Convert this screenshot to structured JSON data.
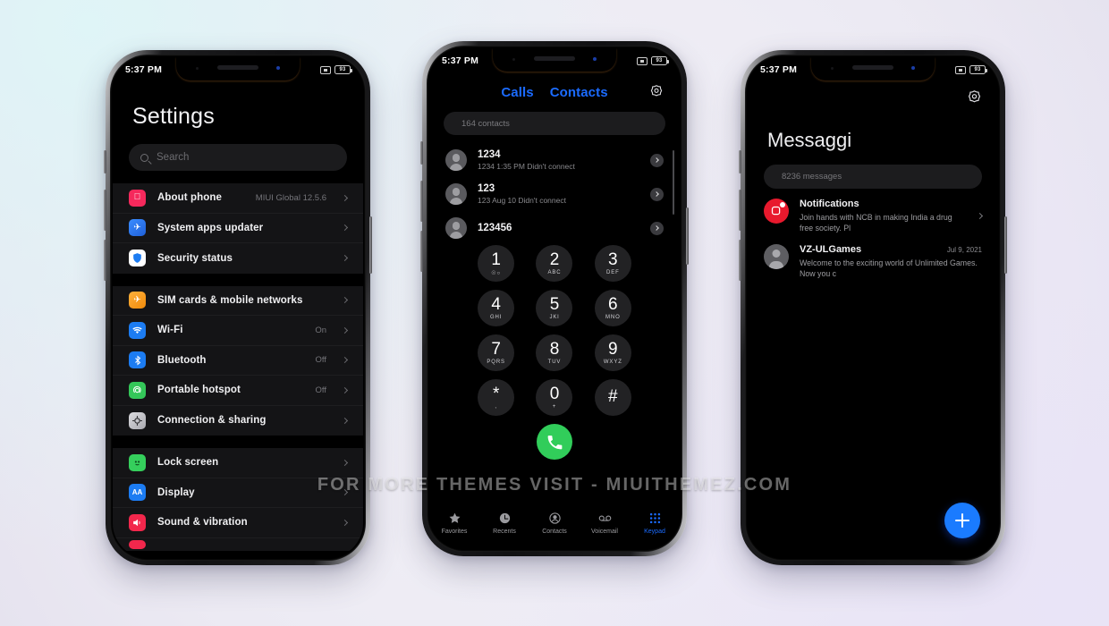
{
  "watermark": "FOR MORE THEMES VISIT - MIUITHEMEZ.COM",
  "colors": {
    "accent_blue": "#1b6bff",
    "fab_blue": "#1a7bff",
    "call_green": "#31cd5a",
    "screen_black": "#000000",
    "row_bg": "#141416"
  },
  "status_bar": {
    "time": "5:37 PM",
    "battery_percent": "93",
    "cast_icon": "cast-icon",
    "battery_icon": "battery-icon"
  },
  "settings_phone": {
    "title": "Settings",
    "search": {
      "placeholder": "Search",
      "icon": "search-icon"
    },
    "groups": [
      {
        "rows": [
          {
            "label": "About phone",
            "value": "MIUI Global 12.5.6",
            "icon": "apple-icon",
            "icon_bg": "#f5295c",
            "icon_glyph": ""
          },
          {
            "label": "System apps updater",
            "value": "",
            "icon": "rocket-icon",
            "icon_bg": "#2a7ff0",
            "icon_glyph": "✈"
          },
          {
            "label": "Security status",
            "value": "",
            "icon": "shield-icon",
            "icon_bg": "#ffffff",
            "icon_glyph": "⬟"
          }
        ]
      },
      {
        "rows": [
          {
            "label": "SIM cards & mobile networks",
            "value": "",
            "icon": "airplane-sim-icon",
            "icon_bg": "#f59b18",
            "icon_glyph": "✈"
          },
          {
            "label": "Wi-Fi",
            "value": "On",
            "icon": "wifi-icon",
            "icon_bg": "#1c7cf2",
            "icon_glyph": "◔"
          },
          {
            "label": "Bluetooth",
            "value": "Off",
            "icon": "bluetooth-icon",
            "icon_bg": "#1c7cf2",
            "icon_glyph": "ᛦ"
          },
          {
            "label": "Portable hotspot",
            "value": "Off",
            "icon": "hotspot-icon",
            "icon_bg": "#34c759",
            "icon_glyph": "@"
          },
          {
            "label": "Connection & sharing",
            "value": "",
            "icon": "gear-share-icon",
            "icon_bg": "#bdbdc2",
            "icon_glyph": "⚙"
          }
        ]
      },
      {
        "rows": [
          {
            "label": "Lock screen",
            "value": "",
            "icon": "lock-screen-icon",
            "icon_bg": "#35cf5c",
            "icon_glyph": "☺"
          },
          {
            "label": "Display",
            "value": "",
            "icon": "display-icon",
            "icon_bg": "#1c7cf2",
            "icon_glyph": "AA"
          },
          {
            "label": "Sound & vibration",
            "value": "",
            "icon": "sound-icon",
            "icon_bg": "#f2274c",
            "icon_glyph": "◀"
          }
        ]
      }
    ]
  },
  "dialer_phone": {
    "tabs": [
      {
        "label": "Calls"
      },
      {
        "label": "Contacts"
      }
    ],
    "settings_icon": "gear-icon",
    "search": {
      "placeholder": "164 contacts",
      "icon": "search-icon"
    },
    "calls": [
      {
        "name": "1234",
        "detail": "1234  1:35 PM Didn't connect"
      },
      {
        "name": "123",
        "detail": "123  Aug 10 Didn't connect"
      },
      {
        "name": "123456",
        "detail": ""
      }
    ],
    "keypad": [
      {
        "num": "1",
        "sub": "☉○"
      },
      {
        "num": "2",
        "sub": "ABC"
      },
      {
        "num": "3",
        "sub": "DEF"
      },
      {
        "num": "4",
        "sub": "GHI"
      },
      {
        "num": "5",
        "sub": "JKl"
      },
      {
        "num": "6",
        "sub": "MNO"
      },
      {
        "num": "7",
        "sub": "PQRS"
      },
      {
        "num": "8",
        "sub": "TUV"
      },
      {
        "num": "9",
        "sub": "WXYZ"
      },
      {
        "num": "*",
        "sub": ","
      },
      {
        "num": "0",
        "sub": "+"
      },
      {
        "num": "#",
        "sub": ""
      }
    ],
    "call_button": "call-button",
    "tabbar": [
      {
        "label": "Favorites",
        "icon": "star-icon",
        "active": false
      },
      {
        "label": "Recents",
        "icon": "clock-icon",
        "active": false
      },
      {
        "label": "Contacts",
        "icon": "person-circle-icon",
        "active": false
      },
      {
        "label": "Voicemail",
        "icon": "voicemail-icon",
        "active": false
      },
      {
        "label": "Keypad",
        "icon": "keypad-icon",
        "active": true
      }
    ]
  },
  "messages_phone": {
    "settings_icon": "gear-icon",
    "title": "Messaggi",
    "search": {
      "placeholder": "8236 messages",
      "icon": "search-icon"
    },
    "threads": [
      {
        "name": "Notifications",
        "date": "",
        "snippet": "Join hands with NCB in making India a drug free society. Pl",
        "icon": "notification-app-icon",
        "icon_bg": "#e8192d",
        "has_chevron": true
      },
      {
        "name": "VZ-ULGames",
        "date": "Jul 9, 2021",
        "snippet": "Welcome to the exciting world of Unlimited Games. Now you c",
        "icon": "person-avatar-icon",
        "icon_bg": "#5e5e62",
        "has_chevron": false
      }
    ],
    "fab": "compose-fab"
  }
}
